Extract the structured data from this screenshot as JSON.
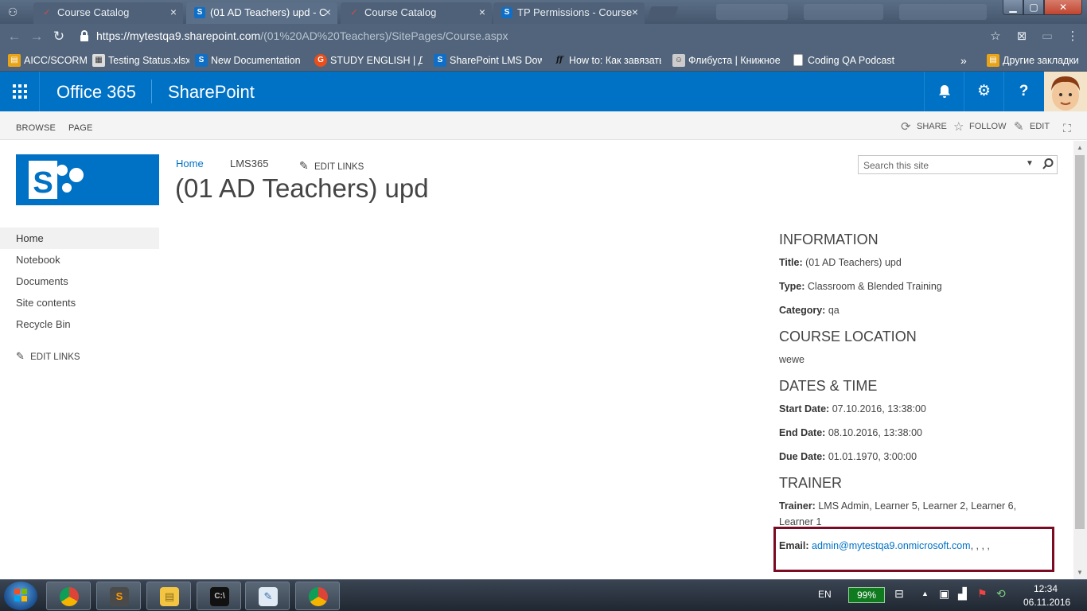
{
  "browser": {
    "tabs": [
      {
        "title": "Course Catalog",
        "favicon": "checkmark-icon",
        "active": false
      },
      {
        "title": "(01 AD Teachers) upd - C",
        "favicon": "sharepoint-icon",
        "active": true
      },
      {
        "title": "Course Catalog",
        "favicon": "checkmark-icon",
        "active": false
      },
      {
        "title": "TP Permissions - Course",
        "favicon": "sharepoint-icon",
        "active": false
      }
    ],
    "tab_close": "×",
    "window_buttons": {
      "minimize": "▁",
      "maximize": "▢",
      "close": "✕"
    },
    "url": {
      "host": "https://mytestqa9.sharepoint.com",
      "path": "/(01%20AD%20Teachers)/SitePages/Course.aspx"
    },
    "bookmarks": [
      {
        "label": "AICC/SCORM",
        "icon": "folder-icon",
        "color": "#e8a317"
      },
      {
        "label": "Testing Status.xlsx",
        "icon": "document-icon",
        "color": "#dddddd"
      },
      {
        "label": "New Documentation",
        "icon": "sharepoint-icon",
        "color": "#0f6fc6"
      },
      {
        "label": "STUDY ENGLISH | ДЛ",
        "icon": "g-icon",
        "color": "#e94e1b"
      },
      {
        "label": "SharePoint LMS Dow",
        "icon": "sharepoint-icon",
        "color": "#0f6fc6"
      },
      {
        "label": "How to: Как завязать",
        "icon": "ff-icon",
        "color": "#333333"
      },
      {
        "label": "Флибуста | Книжное",
        "icon": "library-icon",
        "color": "#cccccc"
      },
      {
        "label": "Coding QA Podcast",
        "icon": "page-icon",
        "color": "#ffffff"
      }
    ],
    "bookmarks_more": "»",
    "other_bookmarks": "Другие закладки"
  },
  "suite": {
    "brand": "Office 365",
    "app": "SharePoint",
    "icons": [
      "bell-icon",
      "gear-icon",
      "help-icon"
    ],
    "help_glyph": "?",
    "accent": "#0072c6"
  },
  "ribbon": {
    "tabs": [
      "BROWSE",
      "PAGE"
    ],
    "actions": {
      "share": "SHARE",
      "follow": "FOLLOW",
      "edit": "EDIT"
    }
  },
  "site": {
    "topnav": {
      "home": "Home",
      "lms": "LMS365",
      "edit_links": "EDIT LINKS"
    },
    "title": "(01 AD Teachers) upd",
    "search_placeholder": "Search this site"
  },
  "quicklaunch": {
    "items": [
      "Home",
      "Notebook",
      "Documents",
      "Site contents",
      "Recycle Bin"
    ],
    "edit_links": "EDIT LINKS"
  },
  "info": {
    "information_heading": "INFORMATION",
    "title_label": "Title:",
    "title_value": "(01 AD Teachers) upd",
    "type_label": "Type:",
    "type_value": "Classroom & Blended Training",
    "category_label": "Category:",
    "category_value": "qa",
    "location_heading": "COURSE LOCATION",
    "location_value": "wewe",
    "dates_heading": "DATES & TIME",
    "start_label": "Start Date:",
    "start_value": "07.10.2016, 13:38:00",
    "end_label": "End Date:",
    "end_value": "08.10.2016, 13:38:00",
    "due_label": "Due Date:",
    "due_value": "01.01.1970, 3:00:00",
    "trainer_heading": "TRAINER",
    "trainer_label": "Trainer:",
    "trainer_value_line1": "LMS Admin, Learner 5, Learner 2, Learner 6,",
    "trainer_value_line2": "Learner 1",
    "email_label": "Email:",
    "email_link": "admin@mytestqa9.onmicrosoft.com",
    "email_rest": ", , , ,"
  },
  "taskbar": {
    "apps": [
      "chrome-icon",
      "sublime-icon",
      "explorer-icon",
      "cmd-icon",
      "notepad-icon",
      "chrome-icon"
    ],
    "lang": "EN",
    "battery": "99%",
    "time": "12:34",
    "date": "06.11.2016"
  }
}
